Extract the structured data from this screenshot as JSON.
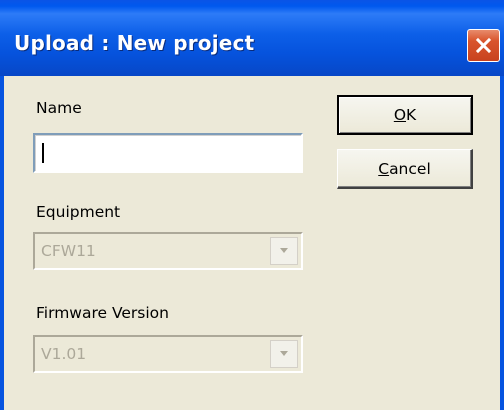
{
  "window": {
    "title": "Upload : New project"
  },
  "form": {
    "name_label": "Name",
    "name_value": "",
    "equipment_label": "Equipment",
    "equipment_value": "CFW11",
    "firmware_label": "Firmware Version",
    "firmware_value": "V1.01"
  },
  "buttons": {
    "ok_mnemonic": "O",
    "ok_rest": "K",
    "cancel_mnemonic": "C",
    "cancel_rest": "ancel"
  },
  "icons": {
    "close": "close-icon",
    "dropdown": "chevron-down-icon"
  },
  "colors": {
    "titlebar": "#0653dd",
    "dialog_bg": "#ece9d8",
    "close_button": "#d9552d",
    "disabled_text": "#aca899"
  }
}
